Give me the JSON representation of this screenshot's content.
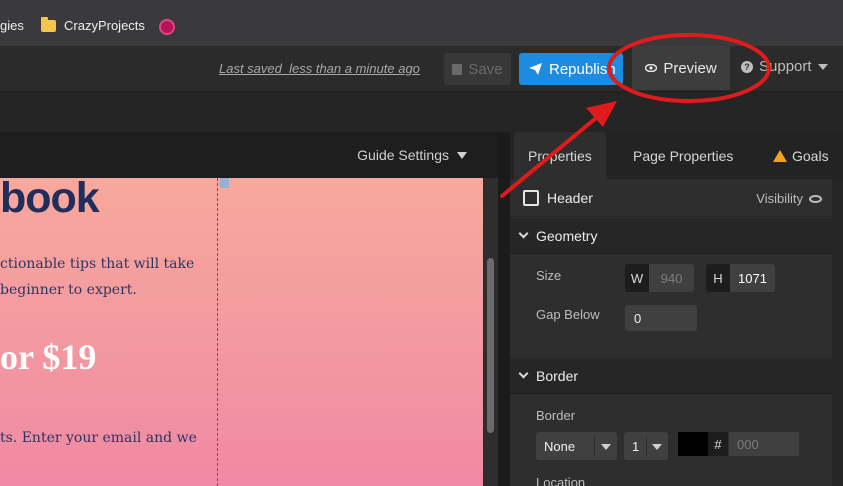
{
  "bookmarks": {
    "items": [
      {
        "label": "gies"
      },
      {
        "label": "CrazyProjects",
        "icon": "folder-icon"
      },
      {
        "label": "",
        "icon": "dribbble-icon"
      }
    ]
  },
  "header": {
    "last_saved": "Last saved  less than a minute ago",
    "save_label": "Save",
    "republish_label": "Republish",
    "preview_label": "Preview",
    "support_label": "Support"
  },
  "canvas": {
    "guide_settings_label": "Guide Settings",
    "page": {
      "heading": "book",
      "body_line1": "ctionable tips that will take",
      "body_line2": "beginner to expert.",
      "price": "or $19",
      "body_line3": "ts. Enter your email and we"
    }
  },
  "properties": {
    "tabs": [
      {
        "label": "Properties",
        "active": true
      },
      {
        "label": "Page Properties",
        "active": false
      },
      {
        "label": "Goals",
        "active": false,
        "icon": "warning-icon"
      }
    ],
    "element_name": "Header",
    "visibility_label": "Visibility",
    "geometry": {
      "title": "Geometry",
      "size_label": "Size",
      "w_tag": "W",
      "w_value": "940",
      "h_tag": "H",
      "h_value": "1071",
      "gap_label": "Gap Below",
      "gap_value": "0"
    },
    "border": {
      "title": "Border",
      "border_label": "Border",
      "style_value": "None",
      "width_value": "1",
      "hash": "#",
      "color_placeholder": "000",
      "location_label": "Location"
    }
  },
  "colors": {
    "accent_blue": "#1d8be0",
    "annotation_red": "#e01b1b",
    "warning_orange": "#f0a023",
    "page_heading": "#1f2e5a"
  }
}
